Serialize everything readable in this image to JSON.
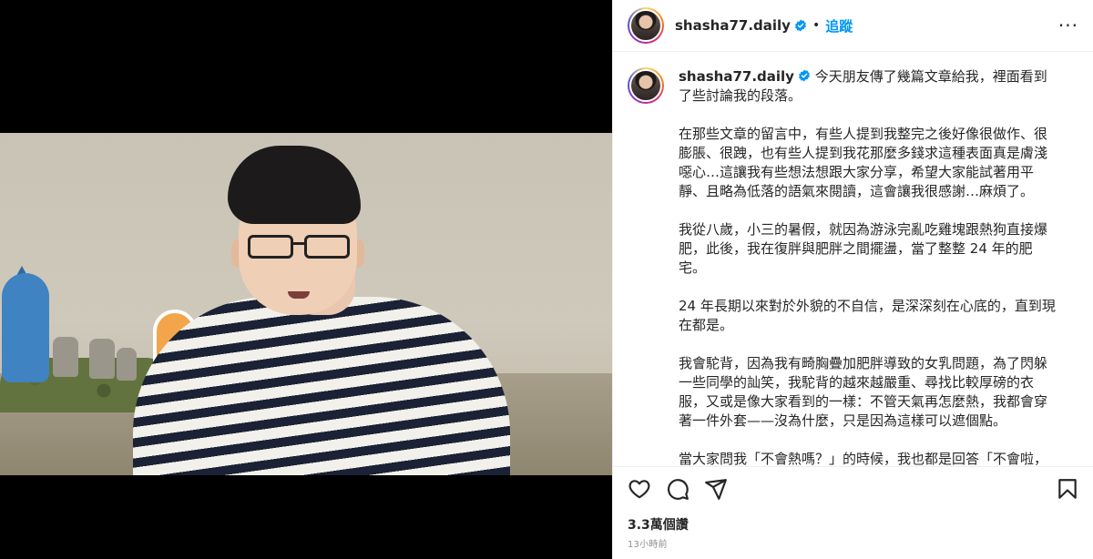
{
  "header": {
    "username": "shasha77.daily",
    "separator": "•",
    "follow_label": "追蹤",
    "more_label": "···"
  },
  "caption": {
    "username": "shasha77.daily",
    "paragraphs": [
      "今天朋友傳了幾篇文章給我，裡面看到了些討論我的段落。",
      "在那些文章的留言中，有些人提到我整完之後好像很做作、很膨脹、很跩，也有些人提到我花那麼多錢求這種表面真是膚淺噁心…這讓我有些想法想跟大家分享，希望大家能試著用平靜、且略為低落的語氣來閱讀，這會讓我很感謝…麻煩了。",
      "我從八歲，小三的暑假，就因為游泳完亂吃雞塊跟熱狗直接爆肥，此後，我在復胖與肥胖之間擺盪，當了整整 24 年的肥宅。",
      "24 年長期以來對於外貌的不自信，是深深刻在心底的，直到現在都是。",
      "我會駝背，因為我有畸胸疊加肥胖導致的女乳問題，為了閃躲一些同學的訕笑，我駝背的越來越嚴重、尋找比較厚磅的衣服，又或是像大家看到的一樣：不管天氣再怎麼熱，我都會穿著一件外套——沒為什麼，只是因為這樣可以遮個點。",
      "當大家問我「不會熱嗎？」的時候，我也都是回答「不會啦，習慣了～」畢竟只是留個汗，比起小時候面對過的訕笑跟眼神，實在好太多了。"
    ]
  },
  "actions": {
    "like_icon": "heart-icon",
    "comment_icon": "comment-icon",
    "share_icon": "share-icon",
    "save_icon": "bookmark-icon"
  },
  "stats": {
    "views": "3.3萬個讚",
    "timestamp": "13小時前"
  },
  "colors": {
    "accent": "#0095f6",
    "verified": "#0095f6",
    "border": "#efefef",
    "muted": "#8e8e8e"
  }
}
